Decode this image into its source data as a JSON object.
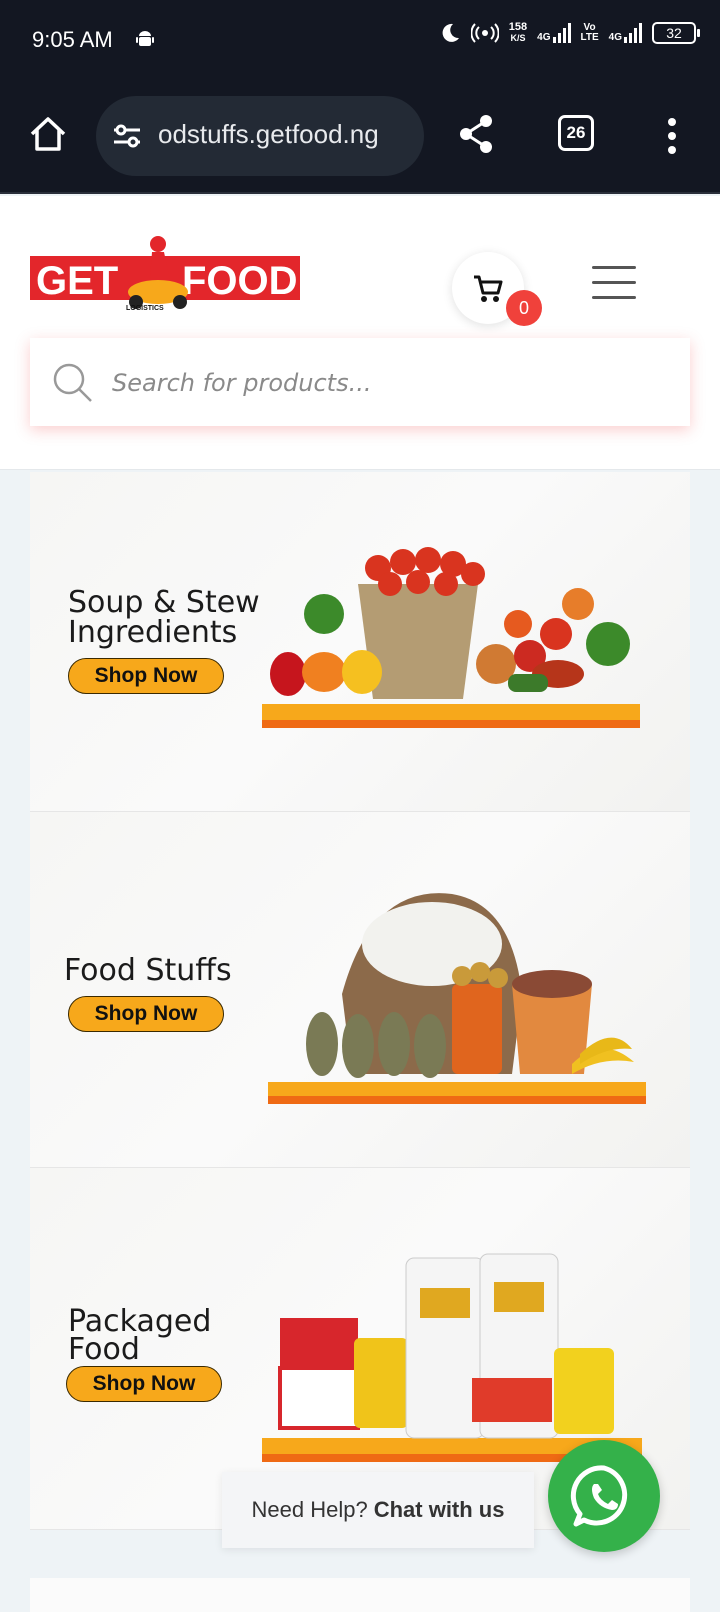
{
  "status": {
    "time": "9:05 AM",
    "net_speed_value": "158",
    "net_speed_unit": "K/S",
    "net1": "4G",
    "volte_top": "Vo",
    "volte_bottom": "LTE",
    "net2": "4G",
    "battery": "32"
  },
  "browser": {
    "url": "odstuffs.getfood.ng",
    "tab_count": "26"
  },
  "header": {
    "logo_text_left": "GET",
    "logo_text_right": "FOOD",
    "logo_sub": "LOGISTICS",
    "cart_count": "0",
    "search_placeholder": "Search for products..."
  },
  "banners": [
    {
      "title_line1": "Soup & Stew",
      "title_line2": "Ingredients",
      "cta": "Shop Now"
    },
    {
      "title_line1": "Food Stuffs",
      "cta": "Shop Now"
    },
    {
      "title_line1": "Packaged",
      "title_line2": "Food",
      "cta": "Shop Now"
    }
  ],
  "chat": {
    "prefix": "Need Help?",
    "action": "Chat with us"
  },
  "colors": {
    "brand_red": "#e3262b",
    "accent_orange": "#f7a81b",
    "whatsapp_green": "#34b14a"
  }
}
